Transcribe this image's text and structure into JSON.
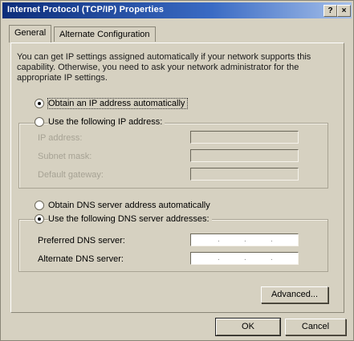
{
  "window": {
    "title": "Internet Protocol (TCP/IP) Properties",
    "help_button": "?",
    "close_button": "×"
  },
  "tabs": [
    {
      "label": "General",
      "active": true
    },
    {
      "label": "Alternate Configuration",
      "active": false
    }
  ],
  "intro_text": "You can get IP settings assigned automatically if your network supports this capability. Otherwise, you need to ask your network administrator for the appropriate IP settings.",
  "ip_options": {
    "auto": {
      "label": "Obtain an IP address automatically",
      "selected": true
    },
    "manual": {
      "label": "Use the following IP address:",
      "selected": false
    },
    "fields": [
      {
        "label": "IP address:",
        "value": ""
      },
      {
        "label": "Subnet mask:",
        "value": ""
      },
      {
        "label": "Default gateway:",
        "value": ""
      }
    ]
  },
  "dns_options": {
    "auto": {
      "label": "Obtain DNS server address automatically",
      "selected": false
    },
    "manual": {
      "label": "Use the following DNS server addresses:",
      "selected": true
    },
    "fields": [
      {
        "label": "Preferred DNS server:",
        "value": ""
      },
      {
        "label": "Alternate DNS server:",
        "value": ""
      }
    ]
  },
  "buttons": {
    "advanced": "Advanced...",
    "ok": "OK",
    "cancel": "Cancel"
  },
  "colors": {
    "title_start": "#0c2d7a",
    "title_end": "#a6c0ea",
    "dialog_face": "#d6d1c1"
  }
}
